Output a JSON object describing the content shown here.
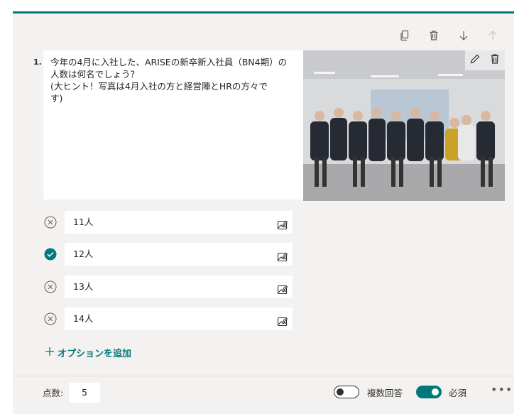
{
  "question": {
    "number": "1.",
    "text": "今年の4月に入社した、ARISEの新卒新入社員（BN4期）の\n人数は何名でしょう？\n(大ヒント！写真は4月入社の方と経営陣とHRの方々で\nす)"
  },
  "options": [
    {
      "label": "11人",
      "correct": false
    },
    {
      "label": "12人",
      "correct": true
    },
    {
      "label": "13人",
      "correct": false
    },
    {
      "label": "14人",
      "correct": false
    }
  ],
  "add_option_label": "オプションを追加",
  "footer": {
    "points_label": "点数:",
    "points_value": "5",
    "multiple_answers_label": "複数回答",
    "multiple_answers_on": false,
    "required_label": "必須",
    "required_on": true,
    "more_label": "•••"
  },
  "colors": {
    "accent": "#03787c",
    "card": "#f3f2f1"
  },
  "icons": [
    "copy-icon",
    "delete-icon",
    "move-down-icon",
    "move-up-icon",
    "edit-icon",
    "image-icon",
    "check-icon",
    "remove-icon",
    "plus-icon"
  ]
}
